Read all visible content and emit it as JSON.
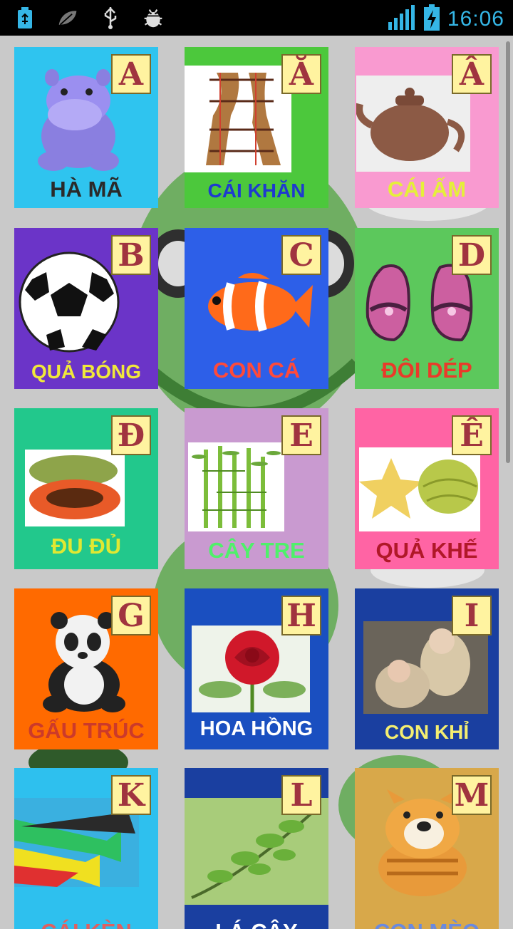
{
  "status_bar": {
    "time": "16:06"
  },
  "cards": [
    {
      "letter": "A",
      "word": "HÀ MÃ"
    },
    {
      "letter": "Ă",
      "word": "CÁI KHĂN"
    },
    {
      "letter": "Â",
      "word": "CÁI ẤM"
    },
    {
      "letter": "B",
      "word": "QUẢ BÓNG"
    },
    {
      "letter": "C",
      "word": "CON CÁ"
    },
    {
      "letter": "D",
      "word": "ĐÔI DÉP"
    },
    {
      "letter": "Đ",
      "word": "ĐU ĐỦ"
    },
    {
      "letter": "E",
      "word": "CÂY TRE"
    },
    {
      "letter": "Ê",
      "word": "QUẢ KHẾ"
    },
    {
      "letter": "G",
      "word": "GẤU TRÚC"
    },
    {
      "letter": "H",
      "word": "HOA HỒNG"
    },
    {
      "letter": "I",
      "word": "CON KHỈ"
    },
    {
      "letter": "K",
      "word": "CÁI KÈN"
    },
    {
      "letter": "L",
      "word": "LÁ CÂY"
    },
    {
      "letter": "M",
      "word": "CON MÈO"
    }
  ]
}
